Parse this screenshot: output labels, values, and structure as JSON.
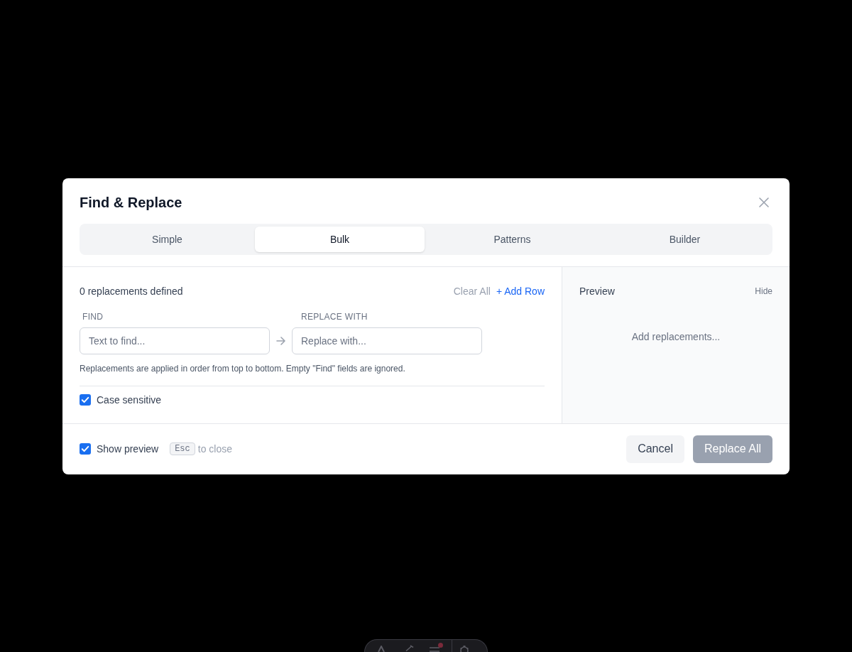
{
  "dialog": {
    "title": "Find & Replace"
  },
  "tabs": [
    {
      "label": "Simple",
      "selected": false
    },
    {
      "label": "Bulk",
      "selected": true
    },
    {
      "label": "Patterns",
      "selected": false
    },
    {
      "label": "Builder",
      "selected": false
    }
  ],
  "bulk": {
    "summary": "0 replacements defined",
    "actions": [
      {
        "label": "Clear All",
        "disabled": true
      },
      {
        "label": "+ Add Row",
        "disabled": false
      }
    ],
    "columns": [
      "FIND",
      "REPLACE WITH"
    ],
    "rows": [
      {
        "find": {
          "placeholder": "Text to find..."
        },
        "replace": {
          "placeholder": "Replace with..."
        }
      }
    ],
    "hint": "Replacements are applied in order from top to bottom. Empty \"Find\" fields are ignored.",
    "case_sensitive": {
      "label": "Case sensitive",
      "checked": true
    }
  },
  "preview": {
    "title": "Preview",
    "toggle": "Hide",
    "empty_message": "Add replacements..."
  },
  "footer": {
    "show_preview": {
      "label": "Show preview",
      "checked": true
    },
    "shortcut": {
      "key": "Esc",
      "text": "to close"
    },
    "buttons": [
      {
        "label": "Cancel",
        "kind": "secondary",
        "disabled": false
      },
      {
        "label": "Replace All",
        "kind": "primary",
        "disabled": true
      }
    ]
  }
}
